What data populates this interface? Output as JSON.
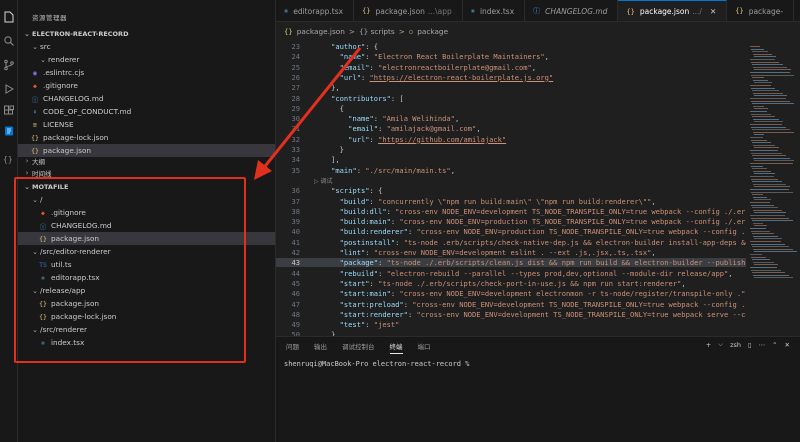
{
  "explorer": {
    "title": "资源管理器",
    "project": "ELECTRON-REACT-RECORD",
    "tree": [
      {
        "label": "src",
        "type": "folder",
        "icon": "folder-open",
        "indent": 1
      },
      {
        "label": "renderer",
        "type": "folder",
        "icon": "folder-open",
        "indent": 2
      },
      {
        "label": ".eslintrc.cjs",
        "type": "file",
        "icon": "eslint",
        "indent": 1
      },
      {
        "label": ".gitignore",
        "type": "file",
        "icon": "git",
        "indent": 1
      },
      {
        "label": "CHANGELOG.md",
        "type": "file",
        "icon": "info",
        "indent": 1
      },
      {
        "label": "CODE_OF_CONDUCT.md",
        "type": "file",
        "icon": "markdown",
        "indent": 1
      },
      {
        "label": "LICENSE",
        "type": "file",
        "icon": "license",
        "indent": 1
      },
      {
        "label": "package-lock.json",
        "type": "file",
        "icon": "json",
        "indent": 1
      },
      {
        "label": "package.json",
        "type": "file",
        "icon": "json",
        "indent": 1,
        "selected": true
      }
    ],
    "outline": "大纲",
    "timeline": "时间线",
    "motafile": {
      "title": "MOTAFILE",
      "tree": [
        {
          "label": "/",
          "type": "folder",
          "indent": 1
        },
        {
          "label": ".gitignore",
          "type": "file",
          "icon": "git",
          "indent": 2
        },
        {
          "label": "CHANGELOG.md",
          "type": "file",
          "icon": "info",
          "indent": 2
        },
        {
          "label": "package.json",
          "type": "file",
          "icon": "json",
          "indent": 2,
          "selected": true
        },
        {
          "label": "/src/editor-renderer",
          "type": "folder",
          "indent": 1
        },
        {
          "label": "util.ts",
          "type": "file",
          "icon": "ts",
          "indent": 2
        },
        {
          "label": "editorapp.tsx",
          "type": "file",
          "icon": "react",
          "indent": 2
        },
        {
          "label": "/release/app",
          "type": "folder",
          "indent": 1
        },
        {
          "label": "package.json",
          "type": "file",
          "icon": "json",
          "indent": 2
        },
        {
          "label": "package-lock.json",
          "type": "file",
          "icon": "json",
          "indent": 2
        },
        {
          "label": "/src/renderer",
          "type": "folder",
          "indent": 1
        },
        {
          "label": "index.tsx",
          "type": "file",
          "icon": "react",
          "indent": 2
        }
      ]
    }
  },
  "tabs": [
    {
      "label": "editorapp.tsx",
      "sub": "",
      "icon": "react",
      "active": false
    },
    {
      "label": "package.json",
      "sub": "...\\app",
      "icon": "json",
      "active": false
    },
    {
      "label": "index.tsx",
      "sub": "",
      "icon": "react",
      "active": false
    },
    {
      "label": "CHANGELOG.md",
      "sub": "",
      "icon": "info",
      "active": false,
      "italic": true
    },
    {
      "label": "package.json",
      "sub": ".../",
      "icon": "json",
      "active": true
    },
    {
      "label": "package-",
      "sub": "",
      "icon": "json",
      "active": false
    }
  ],
  "breadcrumb": [
    "package.json",
    ">",
    "{} scripts",
    ">",
    "package"
  ],
  "editor": {
    "lines": [
      {
        "n": "23",
        "t": [
          [
            "    ",
            "p"
          ],
          [
            "\"author\"",
            "k"
          ],
          [
            ": {",
            "p"
          ]
        ]
      },
      {
        "n": "24",
        "t": [
          [
            "      ",
            "p"
          ],
          [
            "\"name\"",
            "k"
          ],
          [
            ": ",
            "p"
          ],
          [
            "\"Electron React Boilerplate Maintainers\"",
            "s"
          ],
          [
            ",",
            "p"
          ]
        ]
      },
      {
        "n": "25",
        "t": [
          [
            "      ",
            "p"
          ],
          [
            "\"email\"",
            "k"
          ],
          [
            ": ",
            "p"
          ],
          [
            "\"electronreactboilerplate@gmail.com\"",
            "s"
          ],
          [
            ",",
            "p"
          ]
        ]
      },
      {
        "n": "26",
        "t": [
          [
            "      ",
            "p"
          ],
          [
            "\"url\"",
            "k"
          ],
          [
            ": ",
            "p"
          ],
          [
            "\"https://electron-react-boilerplate.js.org\"",
            "u"
          ]
        ]
      },
      {
        "n": "27",
        "t": [
          [
            "    },",
            "p"
          ]
        ]
      },
      {
        "n": "28",
        "t": [
          [
            "    ",
            "p"
          ],
          [
            "\"contributors\"",
            "k"
          ],
          [
            ": [",
            "p"
          ]
        ]
      },
      {
        "n": "29",
        "t": [
          [
            "      {",
            "p"
          ]
        ]
      },
      {
        "n": "30",
        "t": [
          [
            "        ",
            "p"
          ],
          [
            "\"name\"",
            "k"
          ],
          [
            ": ",
            "p"
          ],
          [
            "\"Amila Welihinda\"",
            "s"
          ],
          [
            ",",
            "p"
          ]
        ]
      },
      {
        "n": "31",
        "t": [
          [
            "        ",
            "p"
          ],
          [
            "\"email\"",
            "k"
          ],
          [
            ": ",
            "p"
          ],
          [
            "\"amilajack@gmail.com\"",
            "s"
          ],
          [
            ",",
            "p"
          ]
        ]
      },
      {
        "n": "32",
        "t": [
          [
            "        ",
            "p"
          ],
          [
            "\"url\"",
            "k"
          ],
          [
            ": ",
            "p"
          ],
          [
            "\"https://github.com/amilajack\"",
            "u"
          ]
        ]
      },
      {
        "n": "33",
        "t": [
          [
            "      }",
            "p"
          ]
        ]
      },
      {
        "n": "34",
        "t": [
          [
            "    ],",
            "p"
          ]
        ]
      },
      {
        "n": "35",
        "t": [
          [
            "    ",
            "p"
          ],
          [
            "\"main\"",
            "k"
          ],
          [
            ": ",
            "p"
          ],
          [
            "\"./src/main/main.ts\"",
            "s"
          ],
          [
            ",",
            "p"
          ]
        ]
      },
      {
        "n": "",
        "t": [],
        "codelens": "▷ 调试"
      },
      {
        "n": "36",
        "t": [
          [
            "    ",
            "p"
          ],
          [
            "\"scripts\"",
            "k"
          ],
          [
            ": {",
            "p"
          ]
        ]
      },
      {
        "n": "37",
        "t": [
          [
            "      ",
            "p"
          ],
          [
            "\"build\"",
            "k"
          ],
          [
            ": ",
            "p"
          ],
          [
            "\"concurrently \\\"npm run build:main\\\" \\\"npm run build:renderer\\\"\"",
            "s"
          ],
          [
            ",",
            "p"
          ]
        ]
      },
      {
        "n": "38",
        "t": [
          [
            "      ",
            "p"
          ],
          [
            "\"build:dll\"",
            "k"
          ],
          [
            ": ",
            "p"
          ],
          [
            "\"cross-env NODE_ENV=development TS_NODE_TRANSPILE_ONLY=true webpack --config ./.erb/conf",
            "s"
          ]
        ]
      },
      {
        "n": "39",
        "t": [
          [
            "      ",
            "p"
          ],
          [
            "\"build:main\"",
            "k"
          ],
          [
            ": ",
            "p"
          ],
          [
            "\"cross-env NODE_ENV=production TS_NODE_TRANSPILE_ONLY=true webpack --config ./.erb/conf",
            "s"
          ]
        ]
      },
      {
        "n": "40",
        "t": [
          [
            "      ",
            "p"
          ],
          [
            "\"build:renderer\"",
            "k"
          ],
          [
            ": ",
            "p"
          ],
          [
            "\"cross-env NODE_ENV=production TS_NODE_TRANSPILE_ONLY=true webpack --config ./.erb/c",
            "s"
          ]
        ]
      },
      {
        "n": "41",
        "t": [
          [
            "      ",
            "p"
          ],
          [
            "\"postinstall\"",
            "k"
          ],
          [
            ": ",
            "p"
          ],
          [
            "\"ts-node .erb/scripts/check-native-dep.js && electron-builder install-app-deps && npm",
            "s"
          ]
        ]
      },
      {
        "n": "42",
        "t": [
          [
            "      ",
            "p"
          ],
          [
            "\"lint\"",
            "k"
          ],
          [
            ": ",
            "p"
          ],
          [
            "\"cross-env NODE_ENV=development eslint . --ext .js,.jsx,.ts,.tsx\"",
            "s"
          ],
          [
            ",",
            "p"
          ]
        ]
      },
      {
        "n": "43",
        "cur": true,
        "t": [
          [
            "      ",
            "p"
          ],
          [
            "\"package\"",
            "k"
          ],
          [
            ": ",
            "p"
          ],
          [
            "\"ts-node ./.erb/scripts/clean.js dist && npm run build && electron-builder --publish",
            "s"
          ]
        ]
      },
      {
        "n": "44",
        "t": [
          [
            "      ",
            "p"
          ],
          [
            "\"rebuild\"",
            "k"
          ],
          [
            ": ",
            "p"
          ],
          [
            "\"electron-rebuild --parallel --types prod,dev,optional --module-dir release/app\"",
            "s"
          ],
          [
            ",",
            "p"
          ]
        ]
      },
      {
        "n": "45",
        "t": [
          [
            "      ",
            "p"
          ],
          [
            "\"start\"",
            "k"
          ],
          [
            ": ",
            "p"
          ],
          [
            "\"ts-node ./.erb/scripts/check-port-in-use.js && npm run start:renderer\"",
            "s"
          ],
          [
            ",",
            "p"
          ]
        ]
      },
      {
        "n": "46",
        "t": [
          [
            "      ",
            "p"
          ],
          [
            "\"start:main\"",
            "k"
          ],
          [
            ": ",
            "p"
          ],
          [
            "\"cross-env NODE_ENV=development electronmon -r ts-node/register/transpile-only .\"",
            "s"
          ],
          [
            ",",
            "p"
          ]
        ]
      },
      {
        "n": "47",
        "t": [
          [
            "      ",
            "p"
          ],
          [
            "\"start:preload\"",
            "k"
          ],
          [
            ": ",
            "p"
          ],
          [
            "\"cross-env NODE_ENV=development TS_NODE_TRANSPILE_ONLY=true webpack --config ./.erb/",
            "s"
          ]
        ]
      },
      {
        "n": "48",
        "t": [
          [
            "      ",
            "p"
          ],
          [
            "\"start:renderer\"",
            "k"
          ],
          [
            ": ",
            "p"
          ],
          [
            "\"cross-env NODE_ENV=development TS_NODE_TRANSPILE_ONLY=true webpack serve --config",
            "s"
          ]
        ]
      },
      {
        "n": "49",
        "t": [
          [
            "      ",
            "p"
          ],
          [
            "\"test\"",
            "k"
          ],
          [
            ": ",
            "p"
          ],
          [
            "\"jest\"",
            "s"
          ]
        ]
      },
      {
        "n": "50",
        "t": [
          [
            "    },",
            "p"
          ]
        ]
      }
    ]
  },
  "panel": {
    "tabs": [
      "问题",
      "输出",
      "调试控制台",
      "终端",
      "端口"
    ],
    "active_tab": 3,
    "right": [
      "+",
      "⌵",
      "zsh",
      "▯",
      "⋯",
      "⌃",
      "✕"
    ],
    "terminal": "shenruqi@MacBook-Pro electron-react-record % "
  },
  "colors": {
    "accent": "#0078d4",
    "highlight_box": "#e2301f",
    "arrow": "#e2301f"
  }
}
